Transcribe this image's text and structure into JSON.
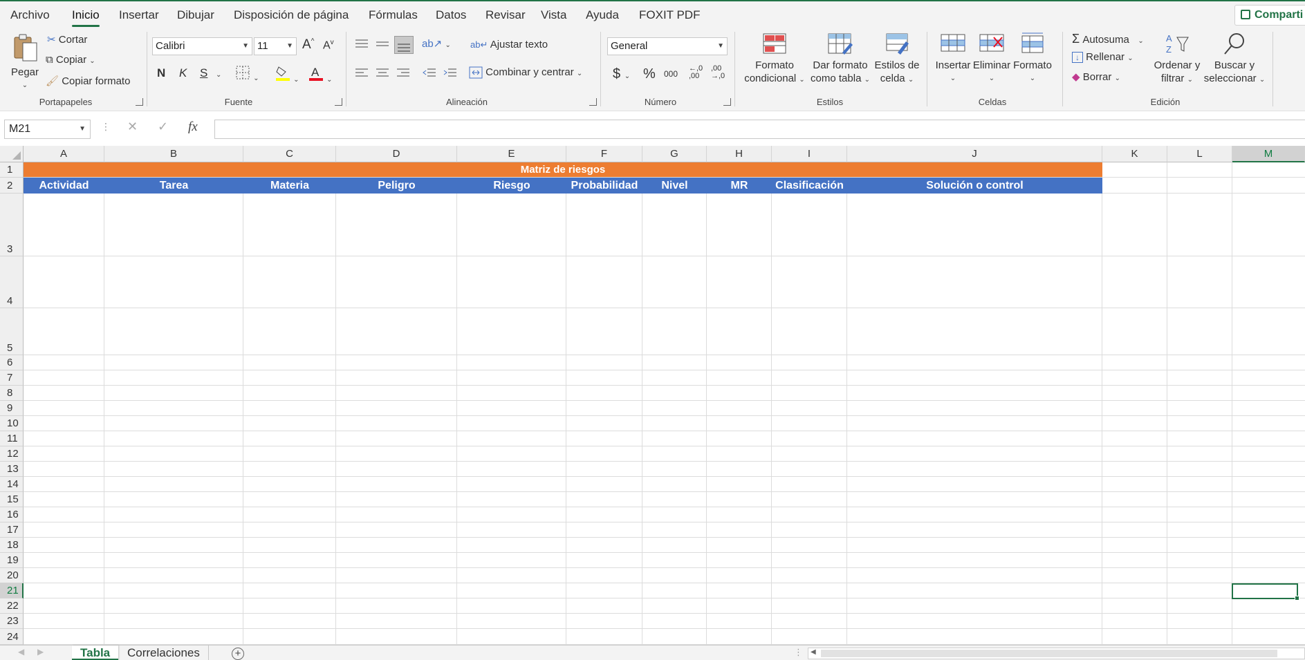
{
  "tabs": [
    "Archivo",
    "Inicio",
    "Insertar",
    "Dibujar",
    "Disposición de página",
    "Fórmulas",
    "Datos",
    "Revisar",
    "Vista",
    "Ayuda",
    "FOXIT PDF"
  ],
  "active_tab": "Inicio",
  "share_label": "Comparti",
  "clipboard": {
    "paste": "Pegar",
    "cut": "Cortar",
    "copy": "Copiar",
    "format_painter": "Copiar formato",
    "group": "Portapapeles"
  },
  "font": {
    "name": "Calibri",
    "size": "11",
    "bold": "N",
    "italic": "K",
    "underline": "S",
    "group": "Fuente"
  },
  "alignment": {
    "wrap": "Ajustar texto",
    "merge": "Combinar y centrar",
    "group": "Alineación"
  },
  "number": {
    "format": "General",
    "currency": "$",
    "percent": "%",
    "thousands": "000",
    "group": "Número"
  },
  "styles": {
    "conditional": [
      "Formato",
      "condicional"
    ],
    "table": [
      "Dar formato",
      "como tabla"
    ],
    "cell": [
      "Estilos de",
      "celda"
    ],
    "group": "Estilos"
  },
  "cells": {
    "insert": "Insertar",
    "delete": "Eliminar",
    "format": "Formato",
    "group": "Celdas"
  },
  "editing": {
    "autosum": "Autosuma",
    "fill": "Rellenar",
    "clear": "Borrar",
    "sort": [
      "Ordenar y",
      "filtrar"
    ],
    "find": [
      "Buscar y",
      "seleccionar"
    ],
    "group": "Edición"
  },
  "formula_bar": {
    "name_box": "M21",
    "formula": ""
  },
  "columns": [
    "A",
    "B",
    "C",
    "D",
    "E",
    "F",
    "G",
    "H",
    "I",
    "J",
    "K",
    "L",
    "M"
  ],
  "active_column": "M",
  "rows": [
    "1",
    "2",
    "3",
    "4",
    "5",
    "6",
    "7",
    "8",
    "9",
    "10",
    "11",
    "12",
    "13",
    "14",
    "15",
    "16",
    "17",
    "18",
    "19",
    "20",
    "21",
    "22",
    "23",
    "24"
  ],
  "active_row": "21",
  "sheet": {
    "title": "Matriz de riesgos",
    "headers": [
      "Actividad",
      "Tarea",
      "Materia",
      "Peligro",
      "Riesgo",
      "Probabilidad",
      "Nivel",
      "MR",
      "Clasificación",
      "Solución o control"
    ]
  },
  "sheet_tabs": [
    "Tabla",
    "Correlaciones"
  ],
  "active_sheet": "Tabla",
  "colors": {
    "accent": "#217346",
    "title_fill": "#ed7d31",
    "header_fill": "#4472c4"
  }
}
